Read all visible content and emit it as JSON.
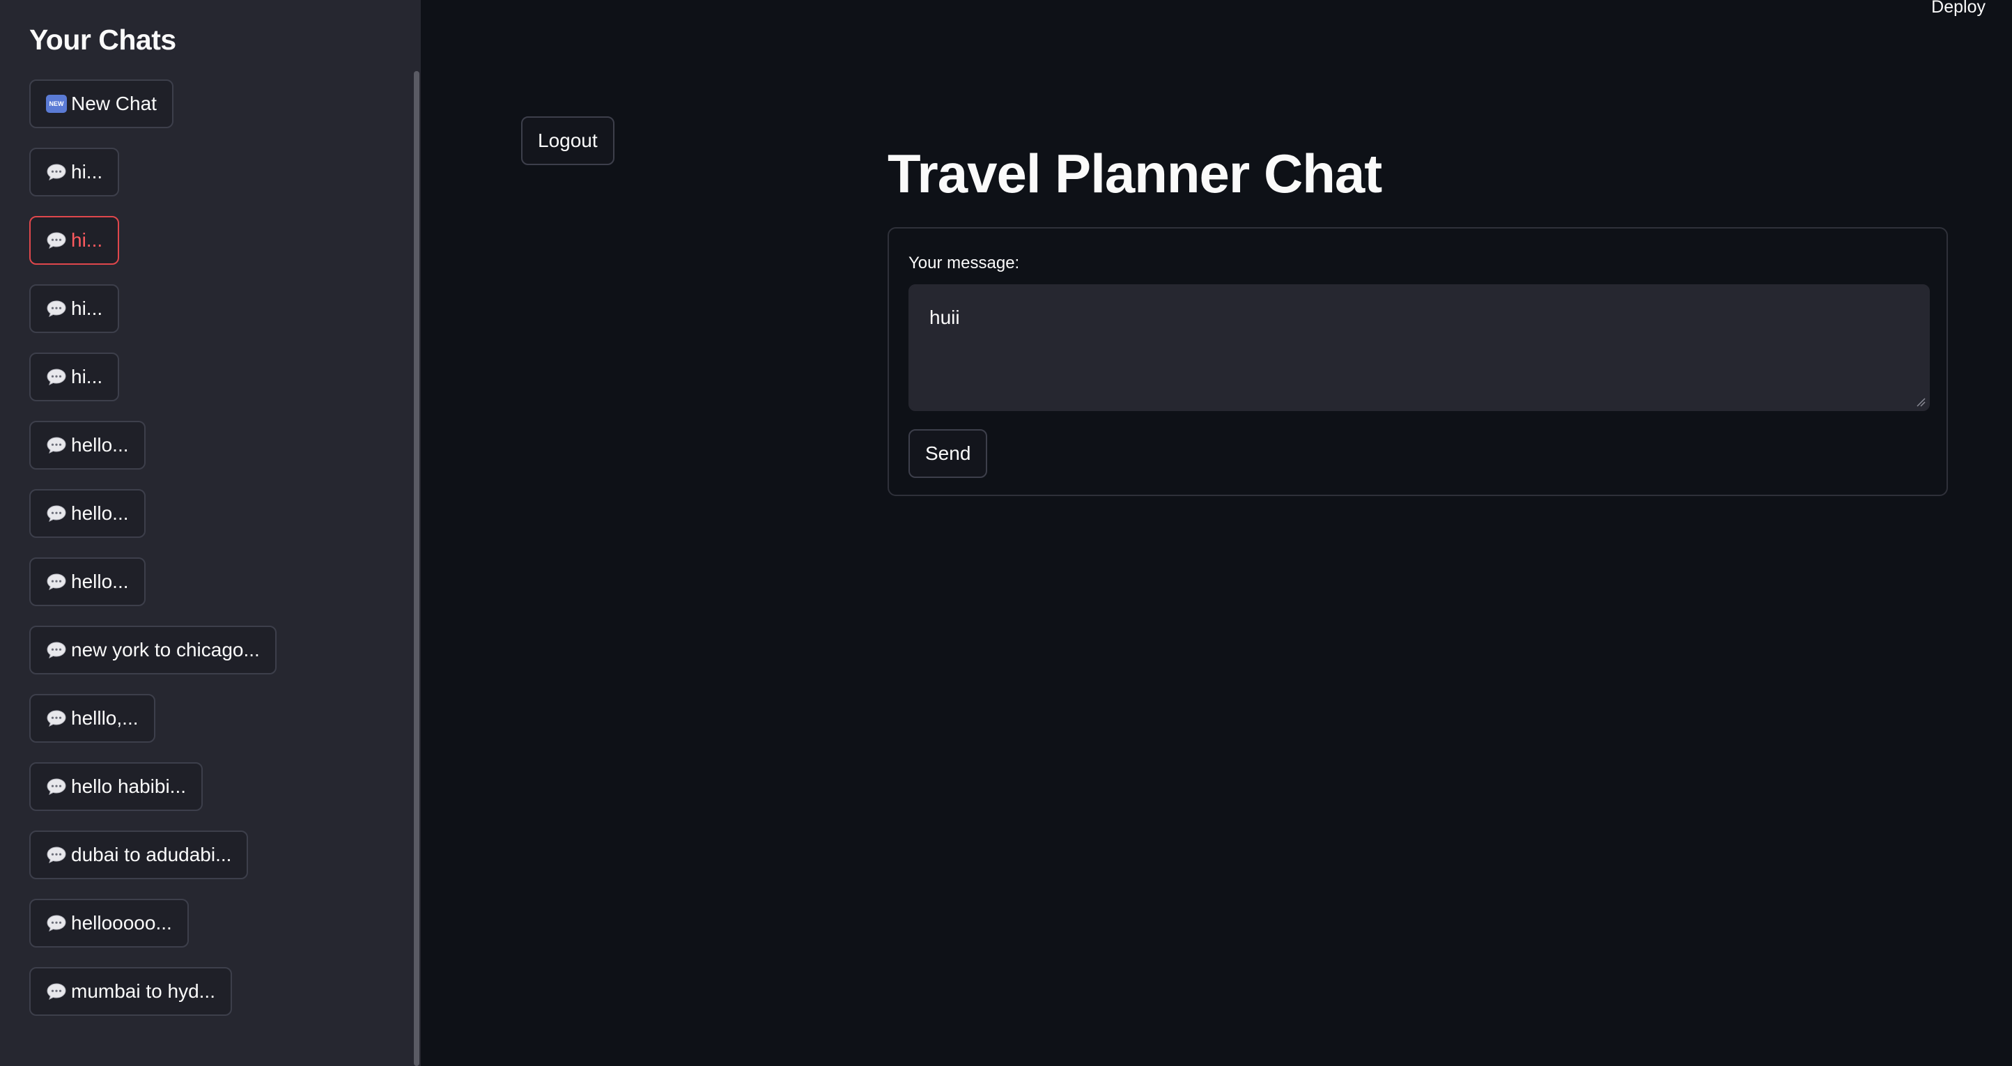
{
  "sidebar": {
    "title": "Your Chats",
    "new_chat": {
      "icon": "new-icon",
      "icon_text": "NEW",
      "label": "New Chat"
    },
    "chats": [
      {
        "label": "hi...",
        "active": false
      },
      {
        "label": "hi...",
        "active": true
      },
      {
        "label": "hi...",
        "active": false
      },
      {
        "label": "hi...",
        "active": false
      },
      {
        "label": "hello...",
        "active": false
      },
      {
        "label": "hello...",
        "active": false
      },
      {
        "label": "hello...",
        "active": false
      },
      {
        "label": "new york to chicago...",
        "active": false
      },
      {
        "label": "helllo,...",
        "active": false
      },
      {
        "label": "hello habibi...",
        "active": false
      },
      {
        "label": "dubai to adudabi...",
        "active": false
      },
      {
        "label": "hellooooo...",
        "active": false
      },
      {
        "label": "mumbai to hyd...",
        "active": false
      }
    ],
    "chat_icon": "speech-bubble-icon"
  },
  "header": {
    "deploy_label": "Deploy"
  },
  "main": {
    "logout_label": "Logout",
    "title": "Travel Planner Chat",
    "form": {
      "message_label": "Your message:",
      "message_value": "huii",
      "send_label": "Send"
    }
  },
  "colors": {
    "app_bg": "#0e1117",
    "sidebar_bg": "#262730",
    "active_accent": "#ff5a5f",
    "button_border": "#3d3f4b"
  }
}
